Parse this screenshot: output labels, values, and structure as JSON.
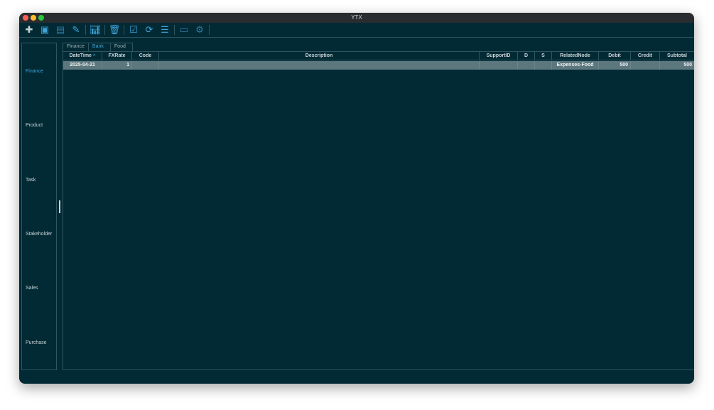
{
  "window": {
    "title": "YTX"
  },
  "colors": {
    "background": "#022a35",
    "accent": "#3ea3d8",
    "selected_row": "#5c777d"
  },
  "toolbar": {
    "icons": [
      "plus-icon",
      "append-icon",
      "insert-icon",
      "edit-icon",
      "chart-add-icon",
      "trash-icon",
      "checklist-icon",
      "refresh-check-icon",
      "list-icon",
      "statement-icon",
      "settings-icon"
    ]
  },
  "sidebar": {
    "items": [
      {
        "label": "Finance",
        "active": true
      },
      {
        "label": "Product"
      },
      {
        "label": "Task"
      },
      {
        "label": "Stakeholder"
      },
      {
        "label": "Sales"
      },
      {
        "label": "Purchase"
      }
    ]
  },
  "tabs": [
    {
      "label": "Finance"
    },
    {
      "label": "Bank",
      "active": true
    },
    {
      "label": "Food"
    }
  ],
  "table": {
    "columns": [
      "DateTime",
      "FXRate",
      "Code",
      "Description",
      "SupportID",
      "D",
      "S",
      "RelatedNode",
      "Debit",
      "Credit",
      "Subtotal"
    ],
    "sort_indicator": "^",
    "rows": [
      [
        "2025-04-21",
        "1",
        "",
        "",
        "",
        "",
        "",
        "Expenses-Food",
        "500",
        "",
        "500"
      ]
    ]
  }
}
